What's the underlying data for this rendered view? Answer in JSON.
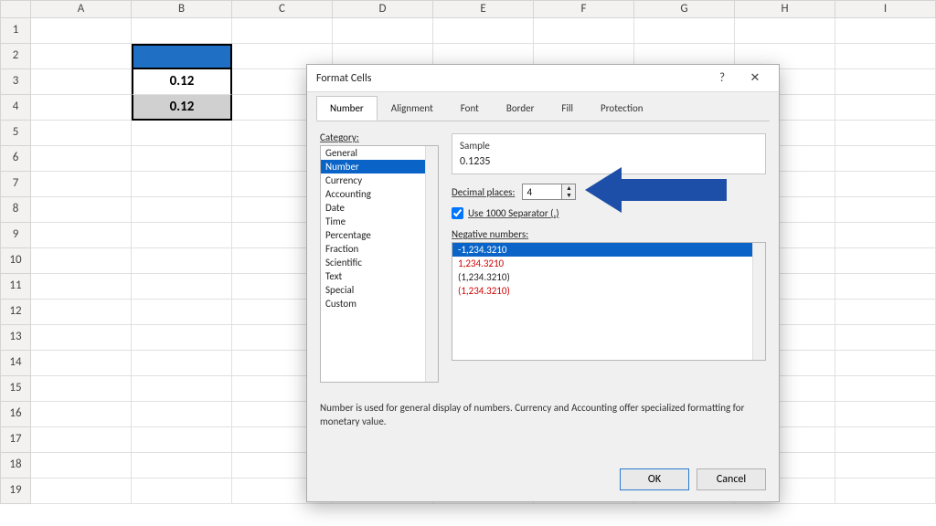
{
  "columns": [
    "A",
    "B",
    "C",
    "D",
    "E",
    "F",
    "G",
    "H",
    "I"
  ],
  "rows": [
    1,
    2,
    3,
    4,
    5,
    6,
    7,
    8,
    9,
    10,
    11,
    12,
    13,
    14,
    15,
    16,
    17,
    18,
    19
  ],
  "cells": {
    "b3": "0.12",
    "b4": "0.12"
  },
  "dialog": {
    "title": "Format Cells",
    "help": "?",
    "close": "✕",
    "tabs": [
      "Number",
      "Alignment",
      "Font",
      "Border",
      "Fill",
      "Protection"
    ],
    "active_tab": 0,
    "category_label": "Category:",
    "categories": [
      "General",
      "Number",
      "Currency",
      "Accounting",
      "Date",
      "Time",
      "Percentage",
      "Fraction",
      "Scientific",
      "Text",
      "Special",
      "Custom"
    ],
    "category_selected": 1,
    "sample_label": "Sample",
    "sample_value": "0.1235",
    "decimal_label": "Decimal places:",
    "decimal_value": "4",
    "sep_label": "Use 1000 Separator (,)",
    "sep_checked": true,
    "neg_label": "Negative numbers:",
    "neg_items": [
      "-1,234.3210",
      "1,234.3210",
      "(1,234.3210)",
      "(1,234.3210)"
    ],
    "neg_selected": 0,
    "neg_red_indices": [
      1,
      3
    ],
    "description": "Number is used for general display of numbers.  Currency and Accounting offer specialized formatting for monetary value.",
    "ok": "OK",
    "cancel": "Cancel"
  }
}
